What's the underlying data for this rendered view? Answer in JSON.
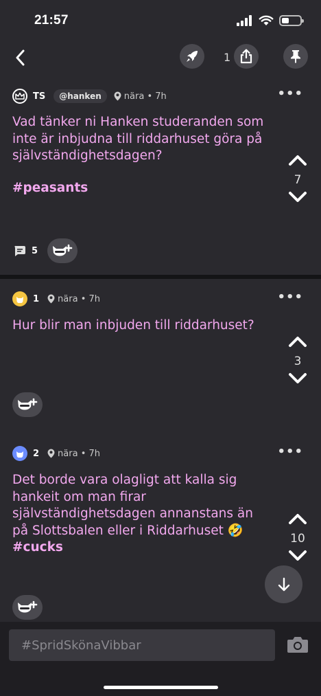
{
  "status": {
    "time": "21:57"
  },
  "topbar": {
    "share_count": "1"
  },
  "post": {
    "author": "TS",
    "tag": "@hanken",
    "location": "nära",
    "age": "• 7h",
    "text": "Vad tänker ni Hanken studeranden som inte är inbjudna till riddarhuset göra på självständighetsdagen?",
    "hashtag": "#peasants",
    "votes": "7",
    "comments": "5"
  },
  "replies": [
    {
      "author": "1",
      "location": "nära",
      "age": "• 7h",
      "text": "Hur blir man inbjuden till riddarhuset?",
      "votes": "3"
    },
    {
      "author": "2",
      "location": "nära",
      "age": "• 7h",
      "text": "Det borde vara olagligt att kalla sig hankeit om man firar självständighetsdagen annanstans än på Slottsbalen eller i Riddarhuset",
      "emoji": "🤣",
      "hashtag": "#cucks",
      "votes": "10"
    }
  ],
  "composer": {
    "placeholder": "#SpridSkönaVibbar"
  },
  "colors": {
    "accent": "#f2a8ee",
    "background": "#2a292e",
    "button": "#4a494f"
  }
}
